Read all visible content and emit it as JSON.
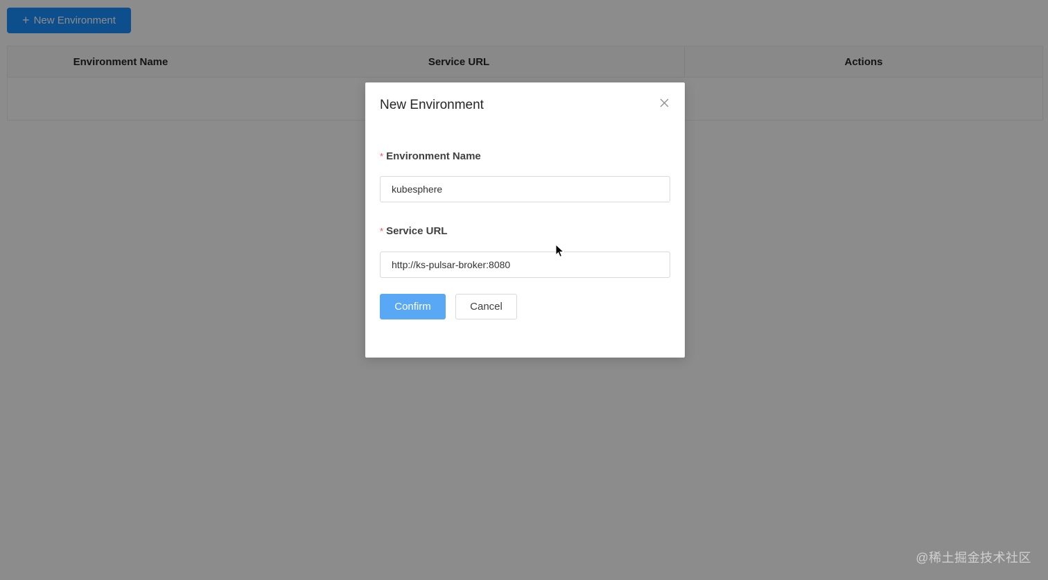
{
  "toolbar": {
    "new_environment_label": "New Environment",
    "plus_icon": "+"
  },
  "table": {
    "columns": [
      "Environment Name",
      "Service URL",
      "Actions"
    ],
    "rows": []
  },
  "modal": {
    "title": "New Environment",
    "close_icon": "close-icon",
    "fields": [
      {
        "label": "Environment Name",
        "required_mark": "*",
        "value": "kubesphere"
      },
      {
        "label": "Service URL",
        "required_mark": "*",
        "value": "http://ks-pulsar-broker:8080"
      }
    ],
    "confirm_label": "Confirm",
    "cancel_label": "Cancel"
  },
  "watermark": "@稀土掘金技术社区",
  "colors": {
    "primary": "#1890ff",
    "confirm": "#58a8f6",
    "required": "#ff4d4f"
  }
}
